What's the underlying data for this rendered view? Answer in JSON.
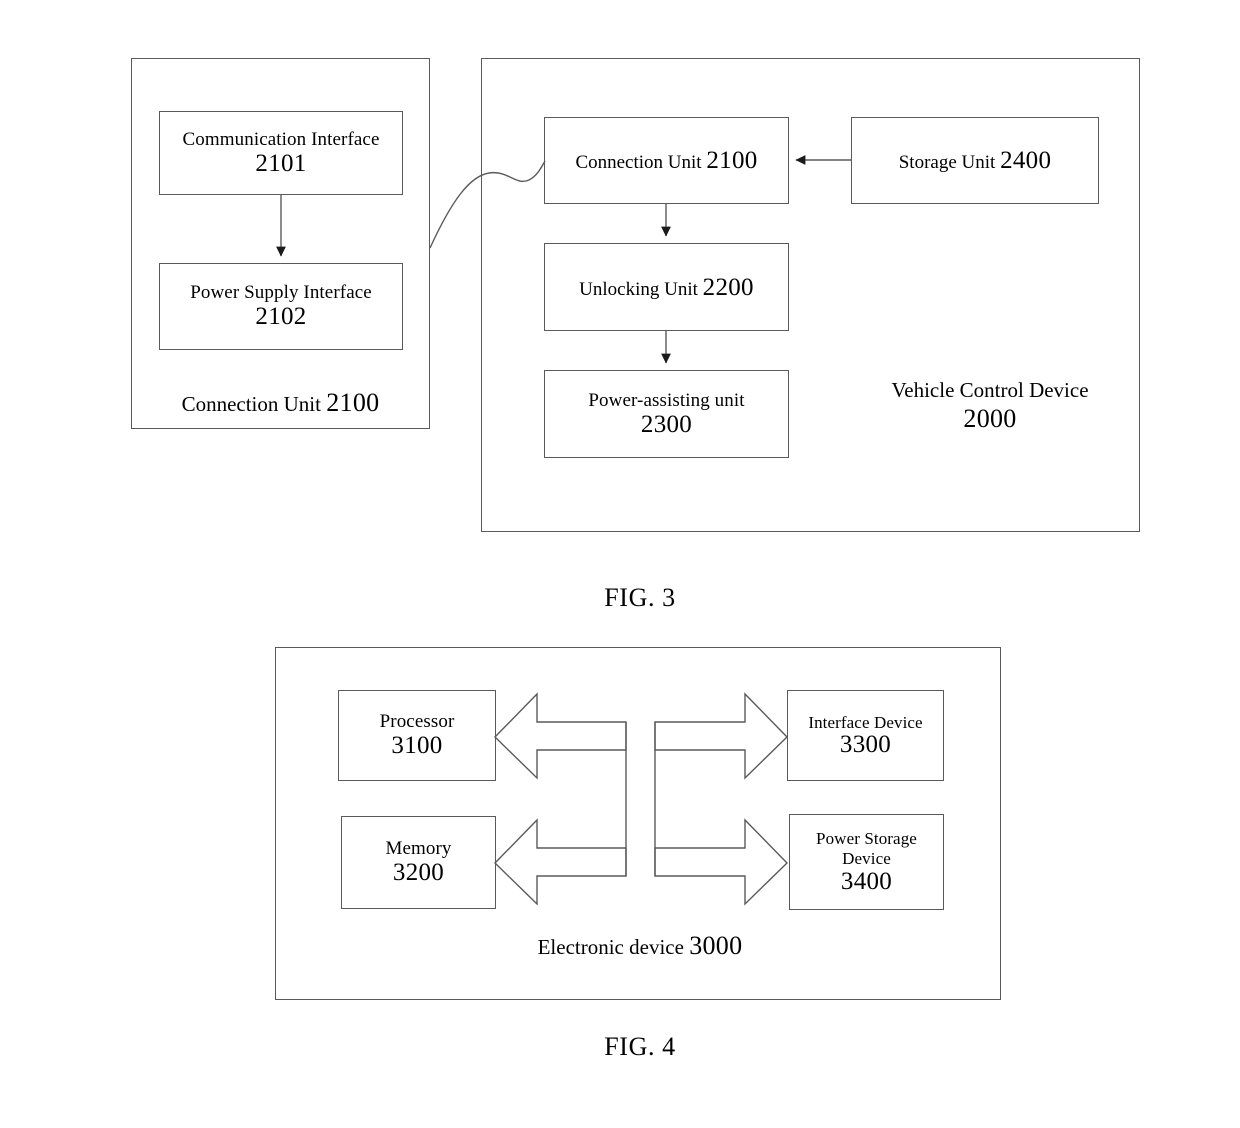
{
  "page": {
    "background": "#ffffff",
    "line_color": "#5a5a5a",
    "text_color": "#000000"
  },
  "figures": [
    {
      "id": "fig3",
      "caption": "FIG. 3",
      "containers": [
        {
          "name": "connection-unit-panel",
          "caption_text": "Connection Unit",
          "caption_number": "2100"
        },
        {
          "name": "vehicle-control-device-panel",
          "caption_text": "Vehicle Control Device",
          "caption_number": "2000"
        }
      ],
      "nodes": [
        {
          "name": "communication-interface",
          "title": "Communication Interface",
          "number": "2101"
        },
        {
          "name": "power-supply-interface",
          "title": "Power Supply Interface",
          "number": "2102"
        },
        {
          "name": "connection-unit",
          "title": "Connection Unit",
          "number": "2100"
        },
        {
          "name": "storage-unit",
          "title": "Storage Unit",
          "number": "2400"
        },
        {
          "name": "unlocking-unit",
          "title": "Unlocking Unit",
          "number": "2200"
        },
        {
          "name": "power-assisting-unit",
          "title": "Power-assisting unit",
          "number": "2300"
        }
      ]
    },
    {
      "id": "fig4",
      "caption": "FIG. 4",
      "containers": [
        {
          "name": "electronic-device-panel",
          "caption_text": "Electronic device",
          "caption_number": "3000"
        }
      ],
      "nodes": [
        {
          "name": "processor",
          "title": "Processor",
          "number": "3100"
        },
        {
          "name": "memory",
          "title": "Memory",
          "number": "3200"
        },
        {
          "name": "interface-device",
          "title": "Interface Device",
          "number": "3300"
        },
        {
          "name": "power-storage-device",
          "title": "Power Storage",
          "title2": "Device",
          "number": "3400"
        }
      ]
    }
  ]
}
